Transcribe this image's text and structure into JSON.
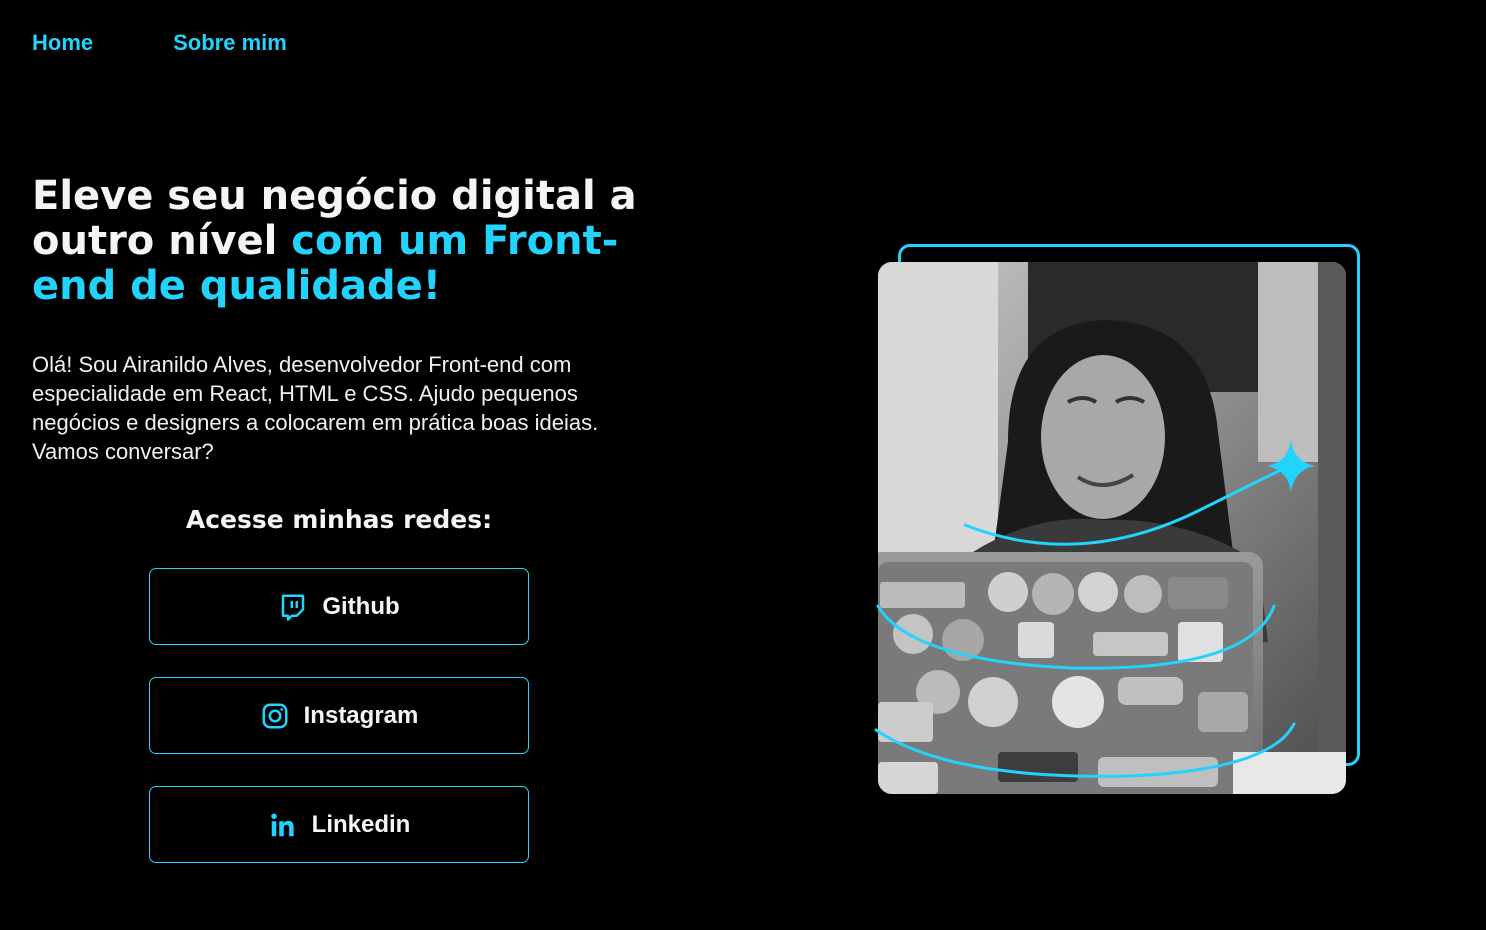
{
  "nav": {
    "items": [
      {
        "label": "Home"
      },
      {
        "label": "Sobre mim"
      }
    ]
  },
  "hero": {
    "headline_white": "Eleve seu negócio digital a outro nível",
    "headline_accent": "com um Front-end de qualidade!",
    "intro": "Olá! Sou Airanildo Alves, desenvolvedor Front-end com especialidade em React, HTML e CSS. Ajudo pequenos negócios e designers a colocarem em prática boas ideias. Vamos conversar?"
  },
  "social": {
    "title": "Acesse minhas redes:",
    "buttons": [
      {
        "label": "Github",
        "icon": "twitch-icon"
      },
      {
        "label": "Instagram",
        "icon": "instagram-icon"
      },
      {
        "label": "Linkedin",
        "icon": "linkedin-icon"
      }
    ]
  },
  "colors": {
    "accent": "#22d4fd",
    "background": "#000000",
    "text": "#f5f5f5"
  }
}
